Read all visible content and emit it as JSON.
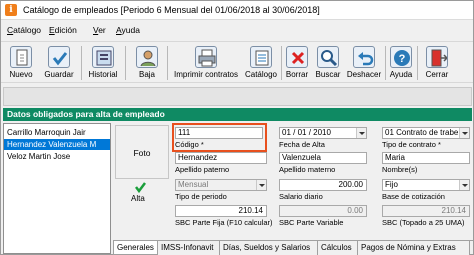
{
  "window": {
    "icon_letter": "i",
    "title": "Catálogo de empleados   [Periodo 6 Mensual del 01/06/2018 al 30/06/2018]"
  },
  "menu": {
    "items": [
      {
        "u": "C",
        "rest": "atálogo"
      },
      {
        "u": "E",
        "rest": "dición"
      },
      {
        "u": "V",
        "rest": "er"
      },
      {
        "u": "A",
        "rest": "yuda"
      }
    ]
  },
  "toolbar": {
    "nuevo": "Nuevo",
    "guardar": "Guardar",
    "historial": "Historial",
    "baja": "Baja",
    "imprimir": "Imprimir contratos",
    "catalogo": "Catálogo",
    "borrar": "Borrar",
    "buscar": "Buscar",
    "deshacer": "Deshacer",
    "ayuda": "Ayuda",
    "cerrar": "Cerrar"
  },
  "section_header": "Datos obligados para alta de empleado",
  "employees": [
    "Carrillo Marroquin Jair",
    "Hernandez Valenzuela M",
    "Veloz Martin Jose"
  ],
  "photo_label": "Foto",
  "alta_label": "Alta",
  "form": {
    "codigo_value": "111",
    "codigo_label": "Código *",
    "fecha_alta_value": "01 / 01 / 2010",
    "fecha_alta_label": "Fecha de Alta",
    "tipo_contrato_value": "01 Contrato de trabe",
    "tipo_contrato_label": "Tipo de contrato *",
    "ap_paterno_value": "Hernandez",
    "ap_paterno_label": "Apellido paterno",
    "ap_materno_value": "Valenzuela",
    "ap_materno_label": "Apellido materno",
    "nombre_value": "Maria",
    "nombre_label": "Nombre(s)",
    "periodo_value": "Mensual",
    "periodo_label": "Tipo de periodo",
    "salario_value": "200.00",
    "salario_label": "Salario diario",
    "base_value": "Fijo",
    "base_label": "Base de cotización",
    "sbc_fija_value": "210.14",
    "sbc_fija_label": "SBC Parte Fija  (F10 calcular)",
    "sbc_var_value": "0.00",
    "sbc_var_label": "SBC Parte Variable",
    "sbc_top_value": "210.14",
    "sbc_top_label": "SBC (Topado a 25 UMA)"
  },
  "tabs": [
    "Generales",
    "IMSS-Infonavit",
    "Días, Sueldos y Salarios",
    "Cálculos",
    "Pagos de Nómina y Extras"
  ],
  "colors": {
    "header_green": "#0f8a63",
    "selection_blue": "#0078d7",
    "highlight_orange": "#e8501e",
    "app_icon_orange": "#f07f1b"
  }
}
